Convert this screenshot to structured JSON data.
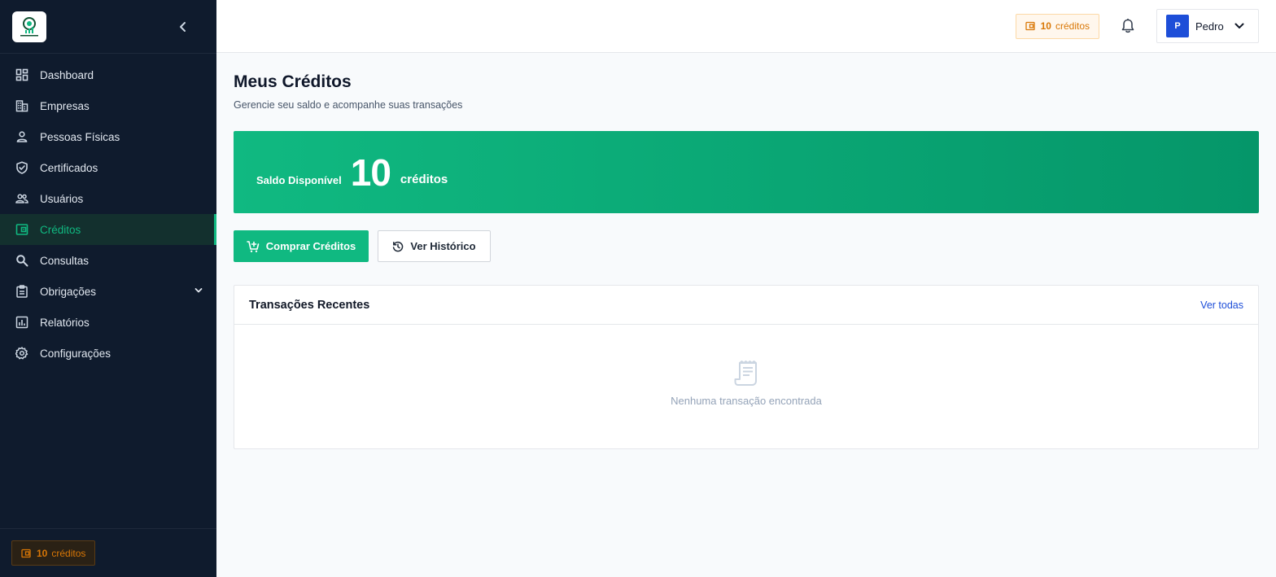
{
  "sidebar": {
    "items": [
      {
        "label": "Dashboard",
        "icon": "dashboard-icon"
      },
      {
        "label": "Empresas",
        "icon": "building-icon"
      },
      {
        "label": "Pessoas Físicas",
        "icon": "person-icon"
      },
      {
        "label": "Certificados",
        "icon": "shield-check-icon"
      },
      {
        "label": "Usuários",
        "icon": "users-icon"
      },
      {
        "label": "Créditos",
        "icon": "wallet-icon",
        "active": true
      },
      {
        "label": "Consultas",
        "icon": "search-icon"
      },
      {
        "label": "Obrigações",
        "icon": "clipboard-icon"
      },
      {
        "label": "Relatórios",
        "icon": "chart-icon"
      },
      {
        "label": "Configurações",
        "icon": "gear-icon"
      }
    ],
    "credits": {
      "value": "10",
      "unit": "créditos"
    }
  },
  "header": {
    "credits": {
      "value": "10",
      "unit": "créditos"
    },
    "user": {
      "initial": "P",
      "name": "Pedro"
    }
  },
  "page": {
    "title": "Meus Créditos",
    "subtitle": "Gerencie seu saldo e acompanhe suas transações"
  },
  "balance": {
    "label": "Saldo Disponível",
    "value": "10",
    "unit": "créditos"
  },
  "actions": {
    "buy_label": "Comprar Créditos",
    "history_label": "Ver Histórico"
  },
  "transactions": {
    "title": "Transações Recentes",
    "view_all": "Ver todas",
    "empty_message": "Nenhuma transação encontrada"
  },
  "colors": {
    "accent": "#10b981",
    "sidebar_bg": "#0f1b2d",
    "credit_orange": "#d97706",
    "avatar_blue": "#1d4ed8"
  }
}
